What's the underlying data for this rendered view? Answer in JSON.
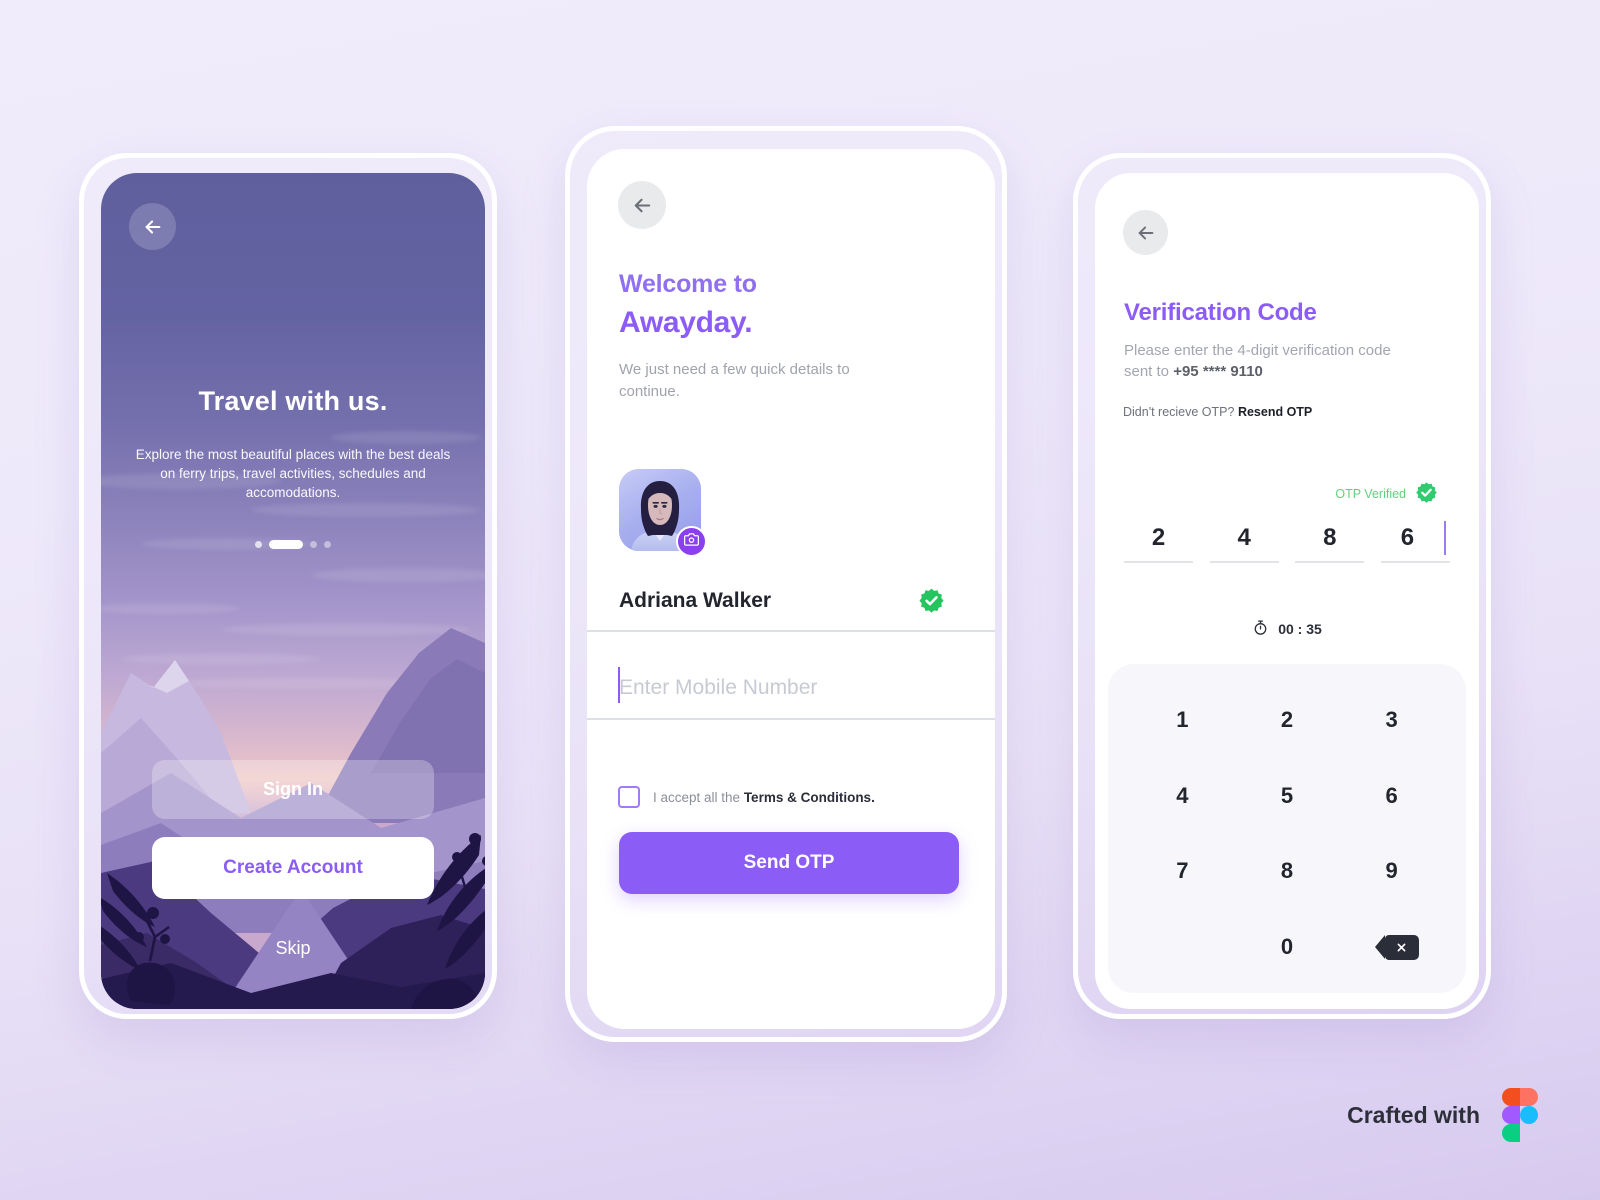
{
  "colors": {
    "accent_purple": "#8b5cf6",
    "deep_purple": "#8b3ff0",
    "green_verified": "#5fd17d",
    "dark_text": "#22252e",
    "muted_text": "#a0a3ae",
    "page_background": "#ede9f8",
    "keypad_background": "#f7f7fb"
  },
  "screen_onboarding": {
    "back_icon": "arrow-left-icon",
    "title": "Travel with us.",
    "subtitle": "Explore the most beautiful places with the best deals on ferry trips, travel activities, schedules and accomodations.",
    "pager": {
      "total": 4,
      "active_index": 1
    },
    "sign_in_label": "Sign In",
    "create_account_label": "Create Account",
    "skip_label": "Skip"
  },
  "screen_welcome": {
    "back_icon": "arrow-left-icon",
    "welcome_line": "Welcome to",
    "brand": "Awayday.",
    "subtitle": "We just need a few quick details to continue.",
    "avatar_alt": "user-profile-photo",
    "camera_icon": "camera-icon",
    "name_value": "Adriana Walker",
    "name_verified_icon": "verified-badge-icon",
    "phone_placeholder": "Enter Mobile Number",
    "phone_value": "",
    "terms_prefix": "I accept all the ",
    "terms_link": "Terms & Conditions.",
    "terms_checked": false,
    "send_otp_label": "Send OTP"
  },
  "screen_otp": {
    "back_icon": "arrow-left-icon",
    "title": "Verification Code",
    "subtitle_prefix": "Please enter the 4-digit verification code sent to ",
    "subtitle_phone": "+95 **** 9110",
    "resend_prefix": "Didn't recieve OTP? ",
    "resend_link": "Resend OTP",
    "verified_label": "OTP Verified",
    "verified_icon": "verified-badge-icon",
    "otp_digits": [
      "2",
      "4",
      "8",
      "6"
    ],
    "timer_icon": "stopwatch-icon",
    "timer_value": "00 : 35",
    "keypad": [
      "1",
      "2",
      "3",
      "4",
      "5",
      "6",
      "7",
      "8",
      "9",
      "",
      "0",
      ""
    ],
    "keypad_check_icon": "check-icon",
    "keypad_backspace_icon": "backspace-icon"
  },
  "footer": {
    "text": "Crafted with",
    "logo": "figma-logo"
  }
}
